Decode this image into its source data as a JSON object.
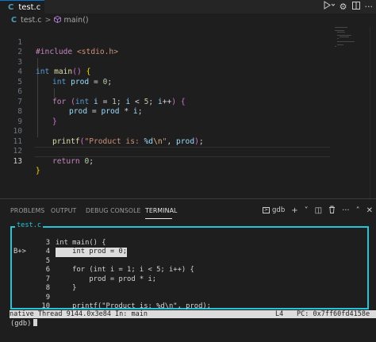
{
  "tab": {
    "language_badge": "C",
    "filename": "test.c"
  },
  "toolbar": {
    "run_icon": "run-debug-icon",
    "settings_icon": "gear-icon",
    "layout_icon": "split-editor-icon",
    "more_icon": "ellipsis-icon"
  },
  "breadcrumb": {
    "language_badge": "C",
    "file": "test.c",
    "separator": ">",
    "symbol": "main()"
  },
  "editor": {
    "line_numbers": [
      "1",
      "2",
      "3",
      "4",
      "5",
      "6",
      "7",
      "8",
      "9",
      "10",
      "11",
      "12",
      "13"
    ],
    "active_line": "13",
    "lines": {
      "l1": {
        "include": "#include",
        "header": "<stdio.h>"
      },
      "l3": {
        "type": "int",
        "name": "main",
        "open": "(",
        "close": ")",
        "brace": "{"
      },
      "l4": {
        "type": "int",
        "var": "prod",
        "eq": "=",
        "val": "0",
        "semi": ";"
      },
      "l6": {
        "kw": "for",
        "open": "(",
        "type": "int",
        "i": "i",
        "eq": "=",
        "one": "1",
        "semi1": ";",
        "i2": "i",
        "lt": "<",
        "five": "5",
        "semi2": ";",
        "i3": "i",
        "inc": "++",
        "close": ")",
        "brace": "{"
      },
      "l7": {
        "v1": "prod",
        "eq": "=",
        "v2": "prod",
        "op": "*",
        "v3": "i",
        "semi": ";"
      },
      "l8": {
        "brace": "}"
      },
      "l10": {
        "fn": "printf",
        "open": "(",
        "str1": "\"Product is: ",
        "fmt": "%d",
        "nl": "\\n",
        "str2": "\"",
        "comma": ", ",
        "var": "prod",
        "close": ")",
        "semi": ";"
      },
      "l12": {
        "kw": "return",
        "val": "0",
        "semi": ";"
      },
      "l13": {
        "brace": "}"
      }
    }
  },
  "panel": {
    "tabs": [
      "PROBLEMS",
      "OUTPUT",
      "DEBUG CONSOLE",
      "TERMINAL"
    ],
    "active_tab": "TERMINAL",
    "terminal_profile": "gdb",
    "actions": {
      "add": "+",
      "chevron": "˅",
      "split": "◫",
      "trash": "🗑",
      "more": "···",
      "maximize": "˄",
      "close": "✕"
    }
  },
  "terminal": {
    "box_title": "test.c",
    "rows": [
      {
        "marker": "",
        "num": "3",
        "code": "int main() {"
      },
      {
        "marker": "B+>",
        "num": "4",
        "code": "    int prod = 0;"
      },
      {
        "marker": "",
        "num": "5",
        "code": ""
      },
      {
        "marker": "",
        "num": "6",
        "code": "    for (int i = 1; i < 5; i++) {"
      },
      {
        "marker": "",
        "num": "7",
        "code": "        prod = prod * i;"
      },
      {
        "marker": "",
        "num": "8",
        "code": "    }"
      },
      {
        "marker": "",
        "num": "9",
        "code": ""
      },
      {
        "marker": "",
        "num": "10",
        "code": "    printf(\"Product is: %d\\n\", prod);"
      }
    ],
    "status_left": "native Thread 9144.0x3e84 In: main",
    "status_line": "L4",
    "status_pc": "PC: 0x7ff60fd4158e",
    "prompt": "(gdb)"
  },
  "colors": {
    "accent": "#0078d4",
    "tui_border": "#26c2d6",
    "keyword": "#569cd6",
    "string": "#ce9178",
    "function": "#dcdcaa",
    "variable": "#9cdcfe",
    "number": "#b5cea8"
  }
}
